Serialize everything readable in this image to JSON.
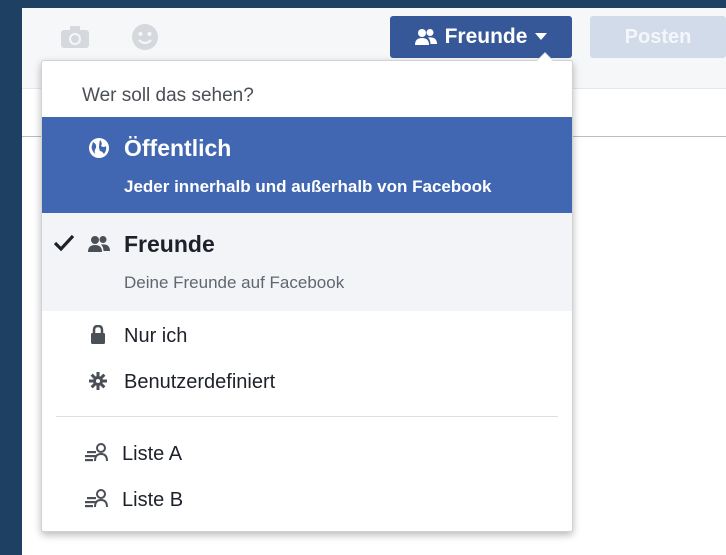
{
  "composer": {
    "audience_label": "Freunde",
    "post_label": "Posten",
    "icons": [
      "camera-icon",
      "smiley-icon"
    ]
  },
  "menu": {
    "heading": "Wer soll das sehen?",
    "options": [
      {
        "title": "Öffentlich",
        "subtitle": "Jeder innerhalb und außerhalb von Facebook",
        "icon": "globe-icon",
        "state": "highlighted"
      },
      {
        "title": "Freunde",
        "subtitle": "Deine Freunde auf Facebook",
        "icon": "friends-icon",
        "state": "selected"
      }
    ],
    "simple_options": [
      {
        "label": "Nur ich",
        "icon": "lock-icon"
      },
      {
        "label": "Benutzerdefiniert",
        "icon": "gear-icon"
      }
    ],
    "lists": [
      {
        "label": "Liste A",
        "icon": "list-person-icon"
      },
      {
        "label": "Liste B",
        "icon": "list-person-icon"
      }
    ]
  },
  "colors": {
    "brand": "#4267b2",
    "button": "#365899",
    "background": "#1d4063"
  }
}
